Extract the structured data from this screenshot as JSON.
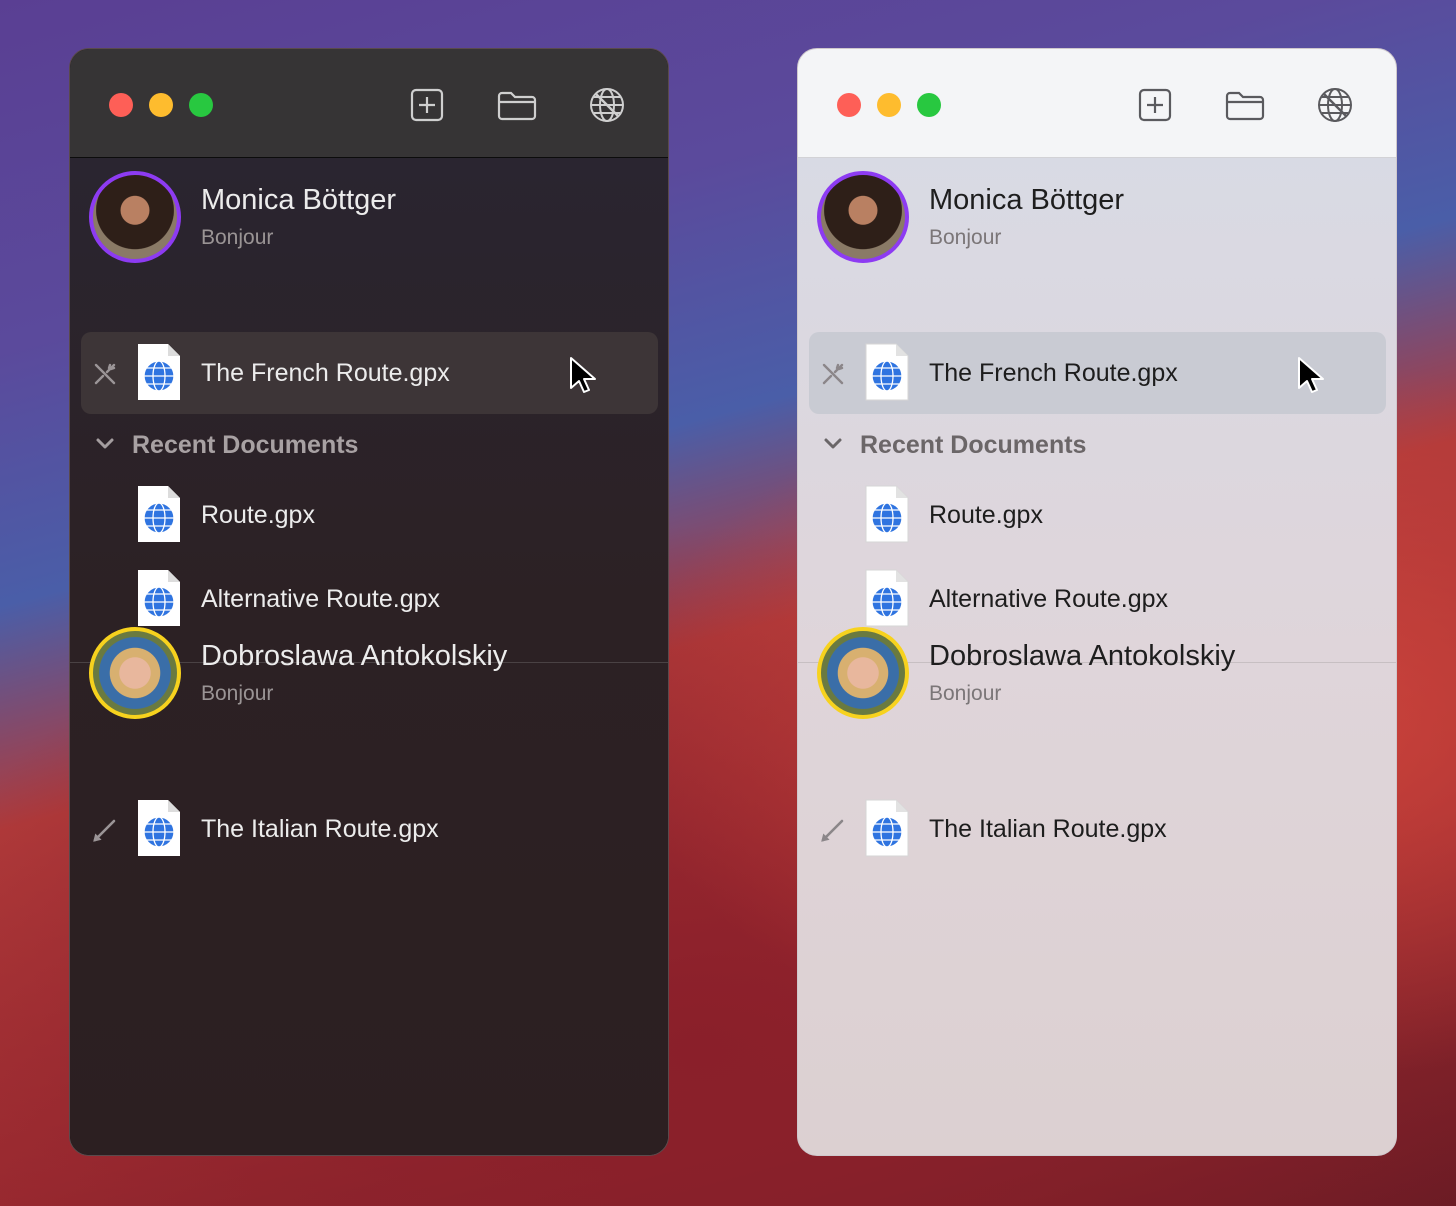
{
  "toolbar": {
    "icons": [
      "new-document-icon",
      "folder-icon",
      "globe-icon"
    ]
  },
  "windows": [
    {
      "theme": "dark",
      "users": [
        {
          "name": "Monica Böttger",
          "status": "Bonjour",
          "accent": "#8d3bf2",
          "documents": [
            {
              "label": "The French Route.gpx",
              "action_icon": "disconnect-icon",
              "selected": true
            }
          ],
          "recent_section": {
            "label": "Recent Documents",
            "items": [
              {
                "label": "Route.gpx"
              },
              {
                "label": "Alternative Route.gpx"
              }
            ]
          }
        },
        {
          "name": "Dobroslawa Antokolskiy",
          "status": "Bonjour",
          "accent": "#f7d21e",
          "documents": [
            {
              "label": "The Italian Route.gpx",
              "action_icon": "pencil-icon",
              "selected": false
            }
          ]
        }
      ]
    },
    {
      "theme": "light",
      "users": [
        {
          "name": "Monica Böttger",
          "status": "Bonjour",
          "accent": "#8d3bf2",
          "documents": [
            {
              "label": "The French Route.gpx",
              "action_icon": "disconnect-icon",
              "selected": true
            }
          ],
          "recent_section": {
            "label": "Recent Documents",
            "items": [
              {
                "label": "Route.gpx"
              },
              {
                "label": "Alternative Route.gpx"
              }
            ]
          }
        },
        {
          "name": "Dobroslawa Antokolskiy",
          "status": "Bonjour",
          "accent": "#f7d21e",
          "documents": [
            {
              "label": "The Italian Route.gpx",
              "action_icon": "pencil-icon",
              "selected": false
            }
          ]
        }
      ]
    }
  ],
  "colors": {
    "traffic_close": "#fe5f57",
    "traffic_minimize": "#febc2e",
    "traffic_maximize": "#28c840",
    "doc_globe": "#2f74e0"
  }
}
